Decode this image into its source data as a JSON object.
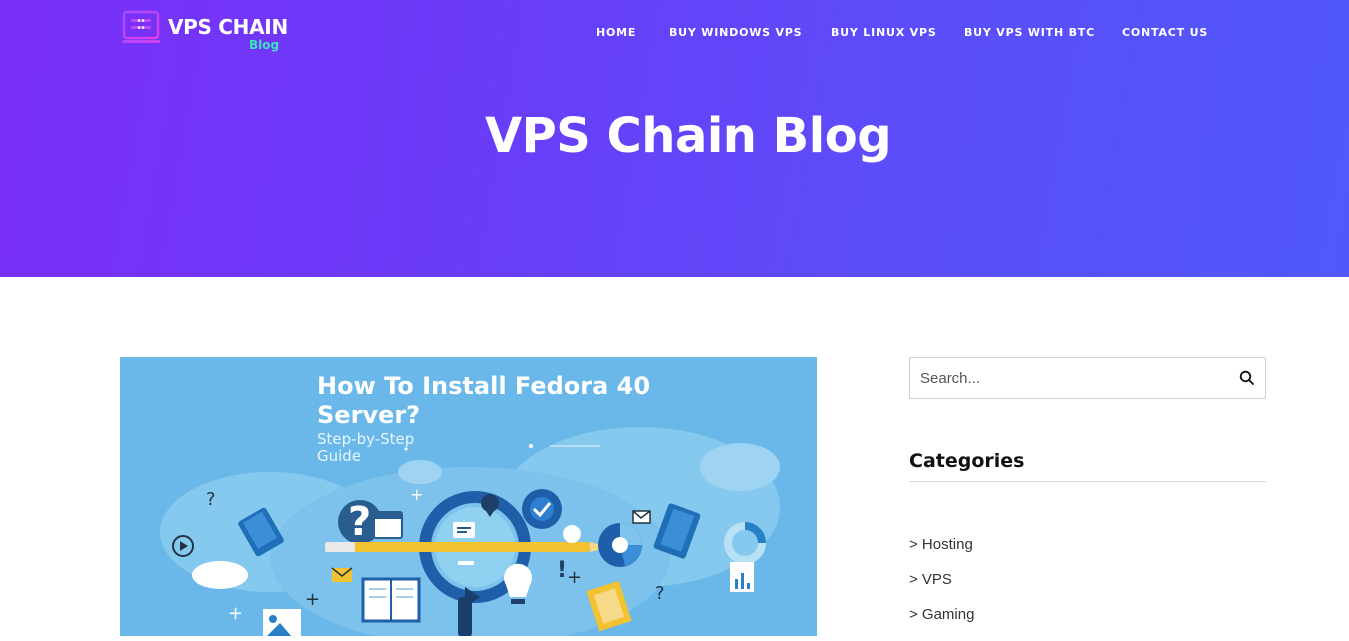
{
  "site": {
    "logo_text": "VPS CHAIN",
    "logo_sub": "Blog",
    "colors": {
      "hero_start": "#7b2ff7",
      "hero_end": "#5158fb",
      "logo_accent": "#3ee0c2",
      "image_bg": "#6ab8ea"
    }
  },
  "nav": {
    "items": [
      {
        "label": "HOME"
      },
      {
        "label": "BUY WINDOWS VPS"
      },
      {
        "label": "BUY LINUX VPS"
      },
      {
        "label": "BUY VPS WITH BTC"
      },
      {
        "label": "CONTACT US"
      }
    ]
  },
  "hero": {
    "title": "VPS Chain Blog"
  },
  "featured": {
    "title": "How To Install Fedora 40 Server?",
    "subtitle": "Step-by-Step Guide"
  },
  "sidebar": {
    "search": {
      "placeholder": "Search...",
      "icon": "search-icon"
    },
    "categories": {
      "heading": "Categories",
      "items": [
        {
          "label": "> Hosting"
        },
        {
          "label": "> VPS"
        },
        {
          "label": "> Gaming"
        }
      ]
    }
  }
}
